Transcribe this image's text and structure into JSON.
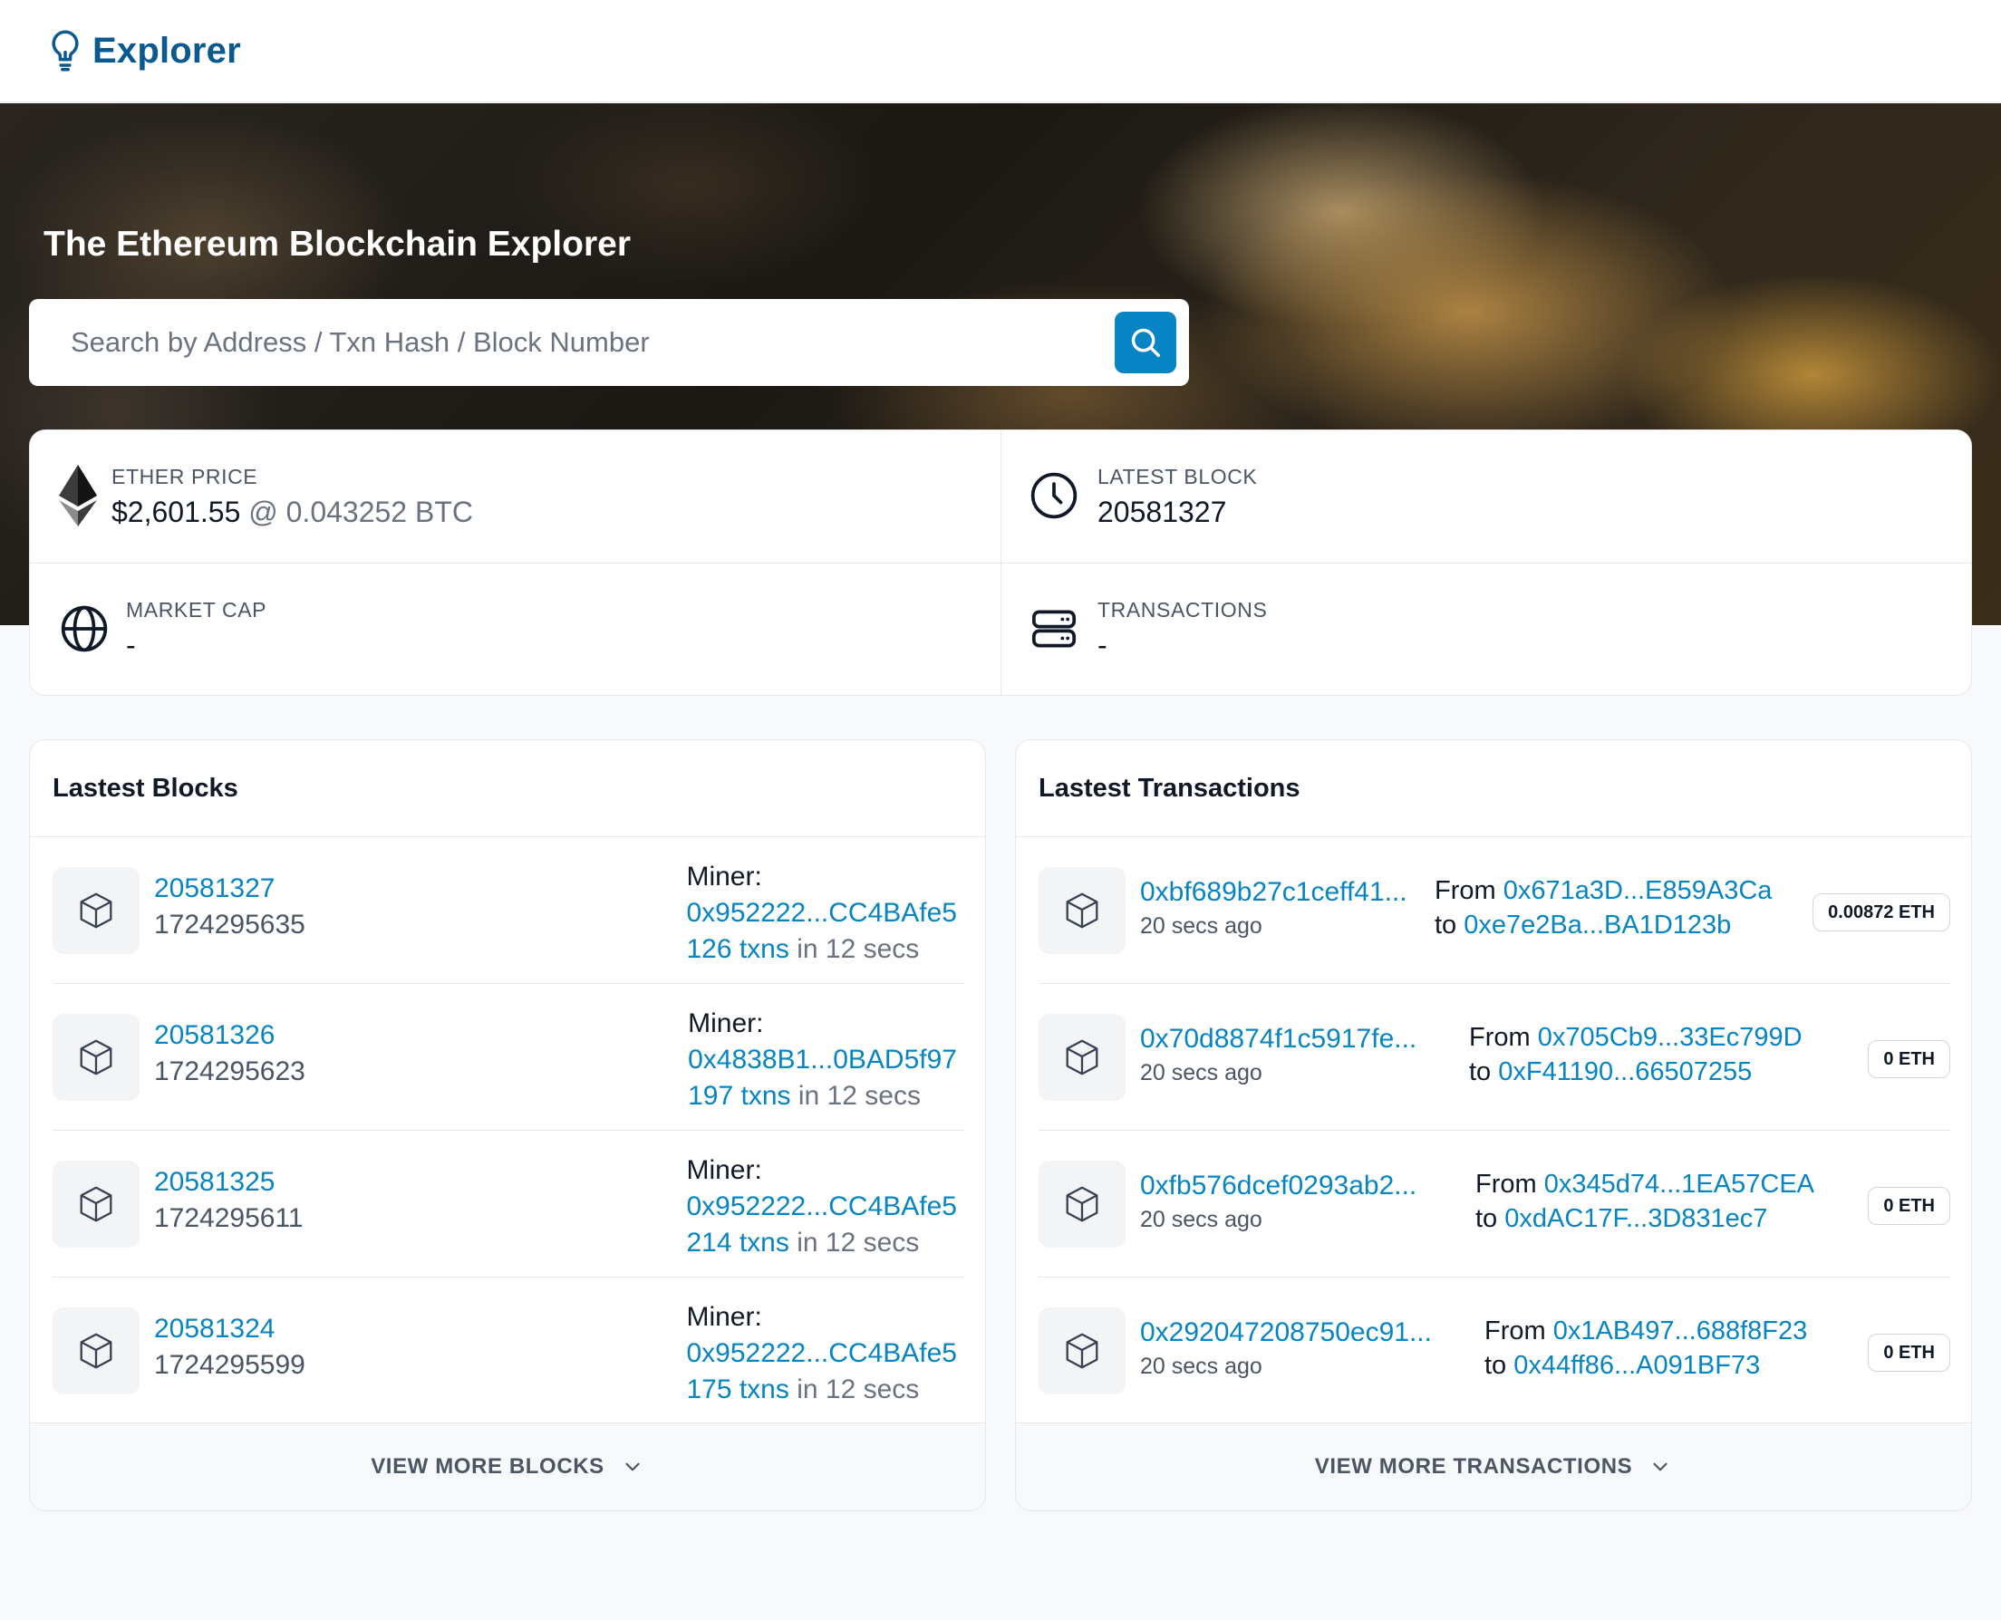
{
  "header": {
    "logo_text": "Explorer"
  },
  "hero": {
    "title": "The Ethereum Blockchain Explorer",
    "search_placeholder": "Search by Address / Txn Hash / Block Number"
  },
  "stats": {
    "ether_price": {
      "label": "ETHER PRICE",
      "usd": "$2,601.55",
      "btc": "@ 0.043252 BTC"
    },
    "latest_block": {
      "label": "LATEST BLOCK",
      "value": "20581327"
    },
    "market_cap": {
      "label": "MARKET CAP",
      "value": "-"
    },
    "transactions": {
      "label": "TRANSACTIONS",
      "value": "-"
    }
  },
  "blocks": {
    "title": "Lastest Blocks",
    "footer": "VIEW MORE BLOCKS",
    "miner_label": "Miner:",
    "items": [
      {
        "number": "20581327",
        "timestamp": "1724295635",
        "miner": "0x952222...CC4BAfe5",
        "txns": "126 txns",
        "time": "in 12 secs"
      },
      {
        "number": "20581326",
        "timestamp": "1724295623",
        "miner": "0x4838B1...0BAD5f97",
        "txns": "197 txns",
        "time": "in 12 secs"
      },
      {
        "number": "20581325",
        "timestamp": "1724295611",
        "miner": "0x952222...CC4BAfe5",
        "txns": "214 txns",
        "time": "in 12 secs"
      },
      {
        "number": "20581324",
        "timestamp": "1724295599",
        "miner": "0x952222...CC4BAfe5",
        "txns": "175 txns",
        "time": "in 12 secs"
      }
    ]
  },
  "transactions": {
    "title": "Lastest Transactions",
    "footer": "VIEW MORE TRANSACTIONS",
    "from_label": "From",
    "to_label": "to",
    "items": [
      {
        "hash": "0xbf689b27c1ceff41...",
        "age": "20 secs ago",
        "from": "0x671a3D...E859A3Ca",
        "to": "0xe7e2Ba...BA1D123b",
        "value": "0.00872 ETH"
      },
      {
        "hash": "0x70d8874f1c5917fe...",
        "age": "20 secs ago",
        "from": "0x705Cb9...33Ec799D",
        "to": "0xF41190...66507255",
        "value": "0 ETH"
      },
      {
        "hash": "0xfb576dcef0293ab2...",
        "age": "20 secs ago",
        "from": "0x345d74...1EA57CEA",
        "to": "0xdAC17F...3D831ec7",
        "value": "0 ETH"
      },
      {
        "hash": "0x292047208750ec91...",
        "age": "20 secs ago",
        "from": "0x1AB497...688f8F23",
        "to": "0x44ff86...A091BF73",
        "value": "0 ETH"
      }
    ]
  },
  "colors": {
    "link": "#0784c3",
    "brand": "#0b5a8f",
    "search_button": "#0784c3"
  },
  "icons": {
    "logo": "lightbulb-icon",
    "search": "search-icon",
    "ether": "ethereum-icon",
    "clock": "clock-icon",
    "globe": "globe-icon",
    "server": "server-icon",
    "cube": "cube-icon",
    "chevron": "chevron-down-icon"
  }
}
